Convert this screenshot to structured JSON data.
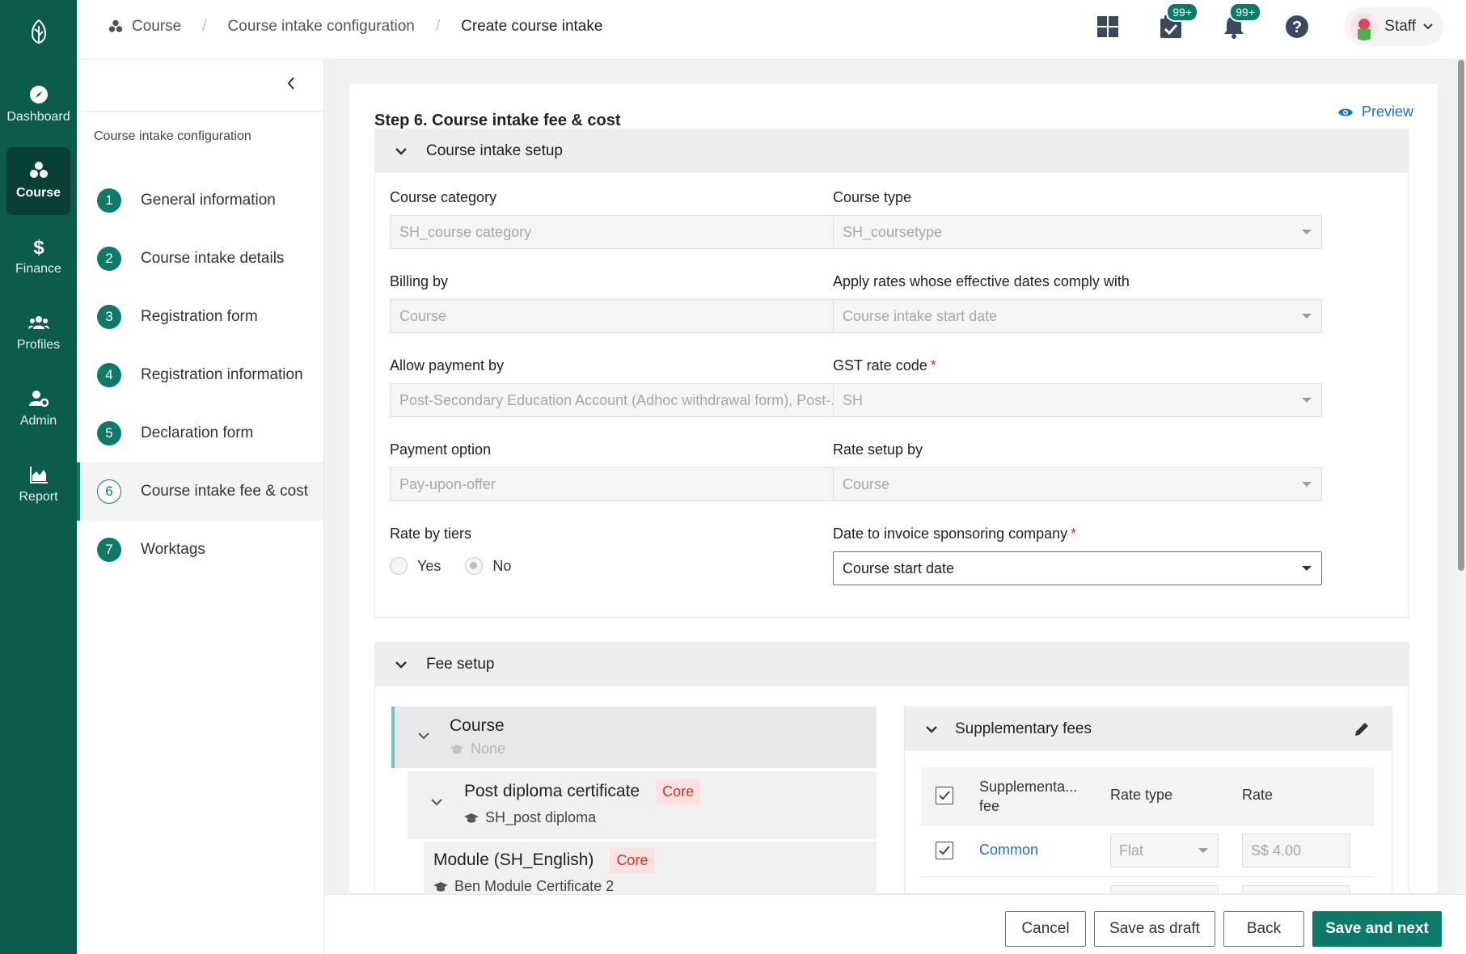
{
  "rail": {
    "items": [
      {
        "label": "Dashboard",
        "icon": "compass-icon"
      },
      {
        "label": "Course",
        "icon": "cubes-icon"
      },
      {
        "label": "Finance",
        "icon": "dollar-icon"
      },
      {
        "label": "Profiles",
        "icon": "users-icon"
      },
      {
        "label": "Admin",
        "icon": "user-gear-icon"
      },
      {
        "label": "Report",
        "icon": "area-chart-icon"
      }
    ],
    "active": "Course"
  },
  "breadcrumb": {
    "root": "Course",
    "parent": "Course intake configuration",
    "current": "Create course intake"
  },
  "header": {
    "tasks_badge": "99+",
    "notifications_badge": "99+",
    "user": "Staff"
  },
  "steps": {
    "title": "Course intake configuration",
    "items": [
      {
        "num": "1",
        "label": "General information"
      },
      {
        "num": "2",
        "label": "Course intake details"
      },
      {
        "num": "3",
        "label": "Registration form"
      },
      {
        "num": "4",
        "label": "Registration information"
      },
      {
        "num": "5",
        "label": "Declaration form"
      },
      {
        "num": "6",
        "label": "Course intake fee & cost"
      },
      {
        "num": "7",
        "label": "Worktags"
      }
    ],
    "active_index": 5
  },
  "page": {
    "title": "Step 6. Course intake fee & cost",
    "preview": "Preview"
  },
  "setup": {
    "heading": "Course intake setup",
    "course_category": {
      "label": "Course category",
      "value": "SH_course category"
    },
    "course_type": {
      "label": "Course type",
      "value": "SH_coursetype"
    },
    "billing_by": {
      "label": "Billing by",
      "value": "Course"
    },
    "apply_rates": {
      "label": "Apply rates whose effective dates comply with",
      "value": "Course intake start date"
    },
    "allow_payment": {
      "label": "Allow payment by",
      "value": "Post-Secondary Education Account (Adhoc withdrawal form), Post-..."
    },
    "gst": {
      "label": "GST rate code",
      "required": "*",
      "value": "SH"
    },
    "payment_option": {
      "label": "Payment option",
      "value": "Pay-upon-offer"
    },
    "rate_setup": {
      "label": "Rate setup by",
      "value": "Course"
    },
    "rate_tiers": {
      "label": "Rate by tiers",
      "yes": "Yes",
      "no": "No",
      "selected": "No"
    },
    "invoice_date": {
      "label": "Date to invoice sponsoring company",
      "required": "*",
      "value": "Course start date"
    }
  },
  "fee": {
    "heading": "Fee setup",
    "course": {
      "title": "Course",
      "sub": "None"
    },
    "programme": {
      "title": "Post diploma certificate",
      "tag": "Core",
      "sub": "SH_post diploma"
    },
    "module": {
      "title": "Module (SH_English)",
      "tag": "Core",
      "sub": "Ben Module Certificate 2"
    },
    "supplementary": {
      "heading": "Supplementary fees",
      "col_fee": "Supplementa... fee",
      "col_rate_type": "Rate type",
      "col_rate": "Rate",
      "rows": [
        {
          "name": "Common",
          "rate_type": "Flat",
          "rate": "S$ 4.00",
          "checked": true
        }
      ]
    }
  },
  "actions": {
    "cancel": "Cancel",
    "save_draft": "Save as draft",
    "back": "Back",
    "save_next": "Save and next"
  }
}
